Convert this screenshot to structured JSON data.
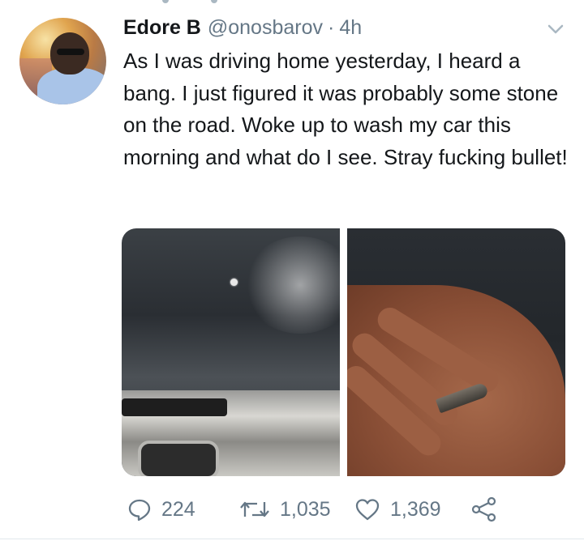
{
  "tweet": {
    "author_name": "Edore B",
    "author_handle": "@onosbarov",
    "separator": "·",
    "timestamp": "4h",
    "text": "As I was driving home yesterday, I heard a bang. I just figured it was probably some stone on the road. Woke up to wash my car this morning and what do I see.  Stray fucking bullet!"
  },
  "actions": {
    "reply_count": "224",
    "retweet_count": "1,035",
    "like_count": "1,369"
  },
  "icons": {
    "more": "chevron-down-icon",
    "reply": "reply-icon",
    "retweet": "retweet-icon",
    "like": "heart-icon",
    "share": "share-icon"
  },
  "colors": {
    "text_primary": "#14171a",
    "text_secondary": "#657786",
    "divider": "#e1e8ed"
  }
}
